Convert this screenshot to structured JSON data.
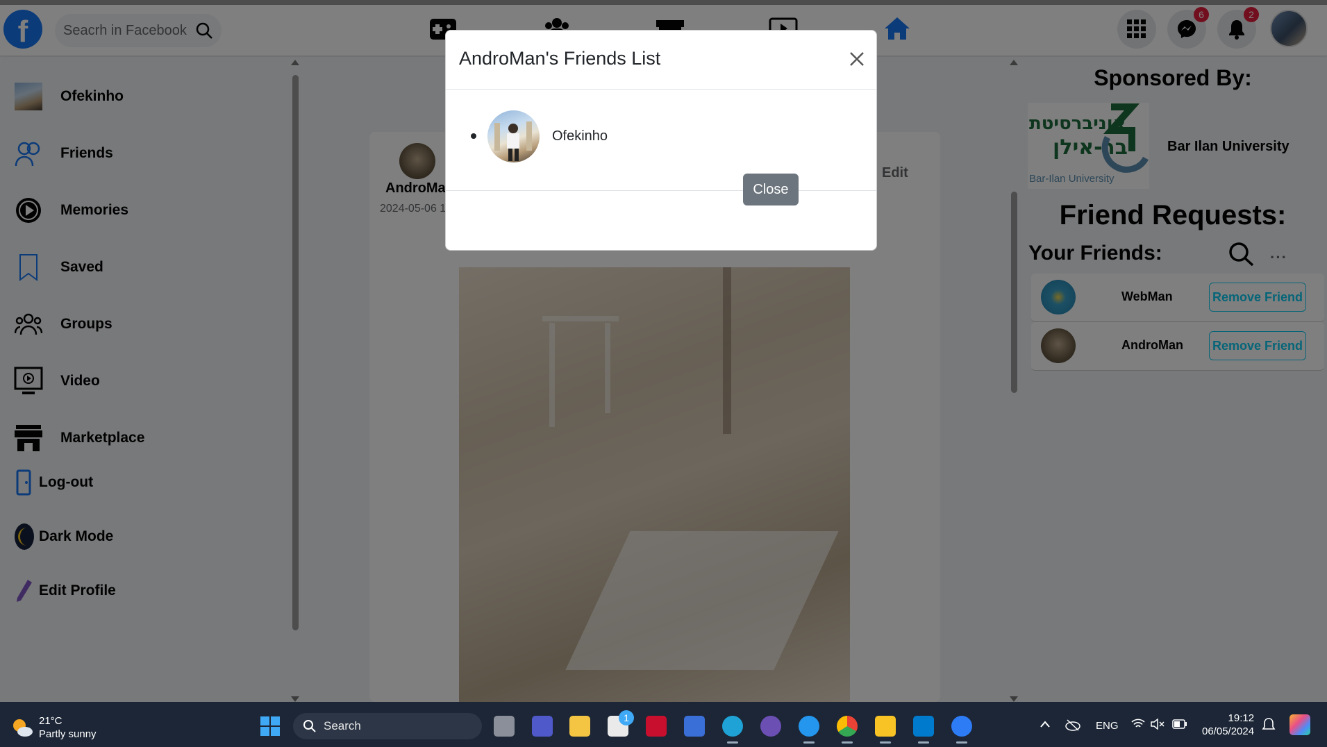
{
  "navbar": {
    "logo": "f",
    "search_placeholder": "Seacrh in Facebook",
    "messenger_count": "6",
    "notifications_count": "2"
  },
  "sidebar": {
    "items": [
      {
        "label": "Ofekinho"
      },
      {
        "label": "Friends"
      },
      {
        "label": "Memories"
      },
      {
        "label": "Saved"
      },
      {
        "label": "Groups"
      },
      {
        "label": "Video"
      },
      {
        "label": "Marketplace"
      },
      {
        "label": "Log-out"
      },
      {
        "label": "Dark Mode"
      },
      {
        "label": "Edit Profile"
      }
    ]
  },
  "post": {
    "author": "AndroMan",
    "date": "2024-05-06 1",
    "edit_label": "Edit"
  },
  "right": {
    "sponsored_title": "Sponsored By:",
    "sponsor_name": "Bar Ilan University",
    "sponsor_logo_hebrew_line1": "אוניברסיטת",
    "sponsor_logo_hebrew_line2": "בר-אילן",
    "sponsor_logo_english": "Bar-Ilan University",
    "friend_requests_title": "Friend Requests:",
    "your_friends_title": "Your Friends:",
    "more": "···",
    "friends": [
      {
        "name": "WebMan",
        "button": "Remove Friend"
      },
      {
        "name": "AndroMan",
        "button": "Remove Friend"
      }
    ]
  },
  "modal": {
    "title": "AndroMan's Friends List",
    "friends": [
      {
        "name": "Ofekinho"
      }
    ],
    "close_button": "Close"
  },
  "taskbar": {
    "temperature": "21°C",
    "weather": "Partly sunny",
    "search_label": "Search",
    "store_badge": "1",
    "language": "ENG",
    "time": "19:12",
    "date": "06/05/2024"
  },
  "colors": {
    "facebook_blue": "#1877f2",
    "badge_red": "#e41e3f",
    "remove_button": "#0dcaf0",
    "close_button": "#6c757d"
  }
}
